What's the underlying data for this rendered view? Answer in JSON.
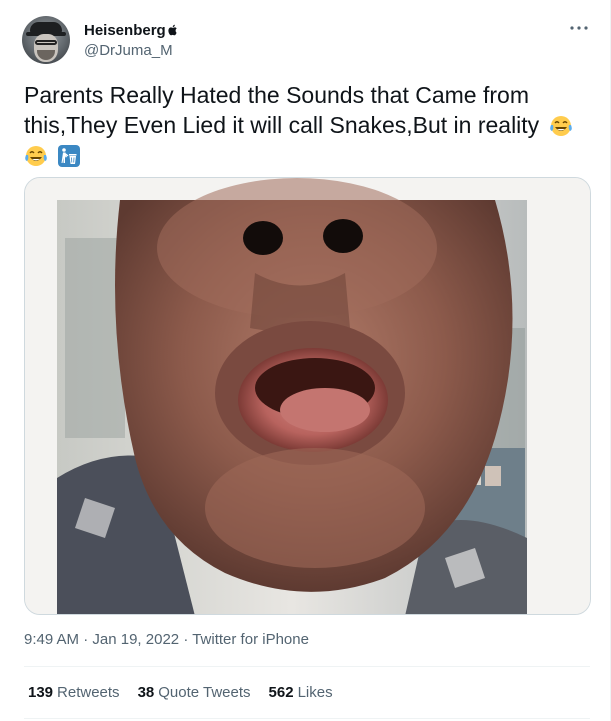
{
  "user": {
    "display_name": "Heisenberg",
    "handle": "@DrJuma_M"
  },
  "tweet": {
    "text": "Parents Really Hated the Sounds that Came from this,They Even Lied it will call Snakes,But in reality",
    "emojis": [
      "face-with-tears-of-joy",
      "face-with-tears-of-joy",
      "litter-in-bin-sign"
    ]
  },
  "meta": {
    "time": "9:49 AM",
    "separator": "·",
    "date": "Jan 19, 2022",
    "source": "Twitter for iPhone"
  },
  "stats": {
    "retweets_count": "139",
    "retweets_label": "Retweets",
    "quotes_count": "38",
    "quotes_label": "Quote Tweets",
    "likes_count": "562",
    "likes_label": "Likes"
  },
  "colors": {
    "text_primary": "#0f1419",
    "text_secondary": "#536471",
    "border": "#cfd9de",
    "emoji_face": "#ffcc4d",
    "emoji_tears": "#5dadec",
    "bin_sign": "#3b88c3"
  }
}
